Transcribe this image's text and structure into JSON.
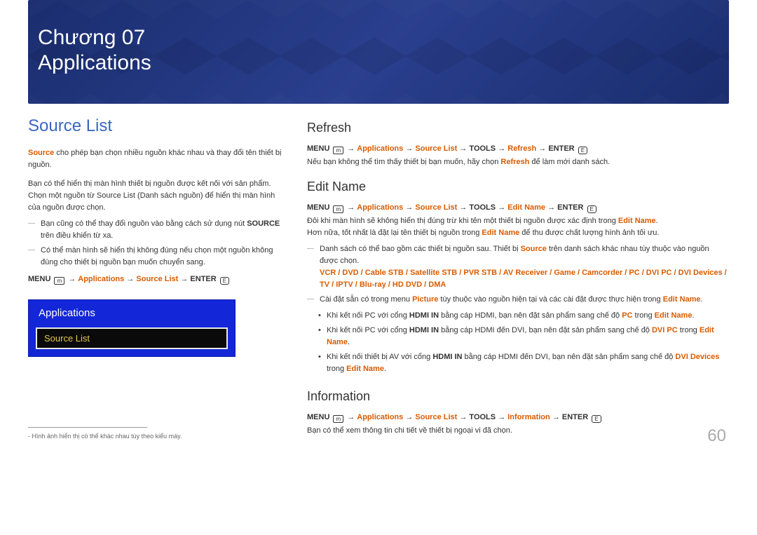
{
  "banner": {
    "line1": "Chương 07",
    "line2": "Applications"
  },
  "left": {
    "heading": "Source List",
    "p1a": "Source",
    "p1b": " cho phép bạn chọn nhiều nguồn khác nhau và thay đổi tên thiết bị nguồn.",
    "p2": "Bạn có thể hiển thị màn hình thiết bị nguồn được kết nối với sản phẩm. Chọn một nguồn từ Source List (Danh sách nguồn) để hiển thị màn hình của nguồn được chọn.",
    "note1a": "Bạn cũng có thể thay đổi nguồn vào bằng cách sử dụng nút ",
    "note1b": "SOURCE",
    "note1c": " trên điều khiển từ xa.",
    "note2": "Có thể màn hình sẽ hiển thị không đúng nếu chọn một nguồn không đúng cho thiết bị nguồn bạn muốn chuyển sang.",
    "path": {
      "menu": "MENU",
      "applications": "Applications",
      "sourcelist": "Source List",
      "enter": "ENTER"
    },
    "osd": {
      "title": "Applications",
      "item": "Source List"
    },
    "footnote": "Hình ảnh hiển thị có thể khác nhau tùy theo kiểu máy."
  },
  "right": {
    "refresh": {
      "heading": "Refresh",
      "path": {
        "menu": "MENU",
        "applications": "Applications",
        "sourcelist": "Source List",
        "tools": "TOOLS",
        "refresh": "Refresh",
        "enter": "ENTER"
      },
      "p1a": "Nếu bạn không thể tìm thấy thiết bị bạn muốn, hãy chọn ",
      "p1b": "Refresh",
      "p1c": " để làm mới danh sách."
    },
    "editname": {
      "heading": "Edit Name",
      "path": {
        "menu": "MENU",
        "applications": "Applications",
        "sourcelist": "Source List",
        "tools": "TOOLS",
        "editname": "Edit Name",
        "enter": "ENTER"
      },
      "p1a": "Đôi khi màn hình sẽ không hiển thị đúng trừ khi tên một thiết bị nguồn được xác định trong ",
      "p1b": "Edit Name",
      "p1c": ".",
      "p2a": "Hơn nữa, tốt nhất là đặt lại tên thiết bị nguồn trong ",
      "p2b": "Edit Name",
      "p2c": " để thu được chất lượng hình ảnh tối ưu.",
      "note1a": "Danh sách có thể bao gồm các thiết bị nguồn sau. Thiết bị ",
      "note1b": "Source",
      "note1c": " trên danh sách khác nhau tùy thuộc vào nguồn được chọn.",
      "devices": "VCR / DVD / Cable STB / Satellite STB / PVR STB / AV Receiver / Game / Camcorder / PC / DVI PC / DVI Devices / TV / IPTV / Blu-ray / HD DVD / DMA",
      "note2a": "Cài đặt sẵn có trong menu ",
      "note2b": "Picture",
      "note2c": " tùy thuộc vào nguồn hiện tại và các cài đặt được thực hiện trong ",
      "note2d": "Edit Name",
      "note2e": ".",
      "b1a": "Khi kết nối PC với cổng ",
      "b1b": "HDMI IN",
      "b1c": " bằng cáp HDMI, bạn nên đặt sản phẩm sang chế độ ",
      "b1d": "PC",
      "b1e": " trong ",
      "b1f": "Edit Name",
      "b1g": ".",
      "b2a": "Khi kết nối PC với cổng ",
      "b2b": "HDMI IN",
      "b2c": " bằng cáp HDMI đến DVI, bạn nên đặt sản phẩm sang chế độ ",
      "b2d": "DVI PC",
      "b2e": " trong ",
      "b2f": "Edit Name",
      "b2g": ".",
      "b3a": "Khi kết nối thiết bị AV với cổng ",
      "b3b": "HDMI IN",
      "b3c": " bằng cáp HDMI đến DVI, bạn nên đặt sản phẩm sang chế độ ",
      "b3d": "DVI Devices",
      "b3e": " trong ",
      "b3f": "Edit Name",
      "b3g": "."
    },
    "information": {
      "heading": "Information",
      "path": {
        "menu": "MENU",
        "applications": "Applications",
        "sourcelist": "Source List",
        "tools": "TOOLS",
        "information": "Information",
        "enter": "ENTER"
      },
      "p1": "Bạn có thể xem thông tin chi tiết về thiết bị ngoại vi đã chọn."
    }
  },
  "pagenum": "60",
  "arrow": "→",
  "menuicon": "m",
  "entericon": "E"
}
